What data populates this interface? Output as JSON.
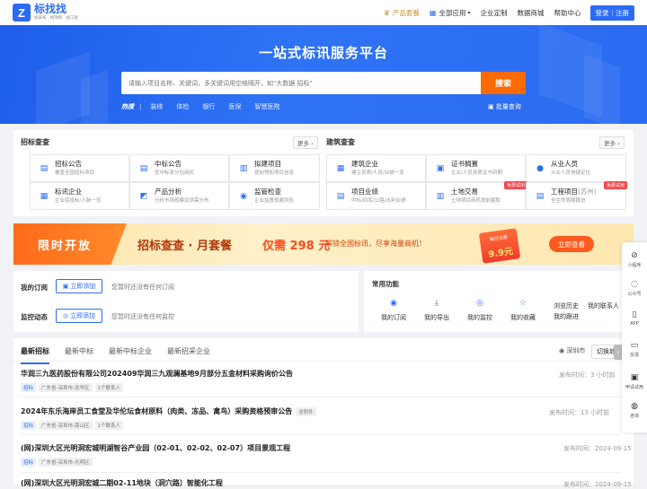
{
  "header": {
    "logo_name": "标找找",
    "logo_slogan": "找采购 · 找项目 · 找工程",
    "nav": {
      "product": "产品套餐",
      "apps": "全部应用",
      "enterprise": "企业定制",
      "data": "数据商城",
      "help": "帮助中心",
      "login": "登录｜注册"
    }
  },
  "hero": {
    "title": "一站式标讯服务平台",
    "search_placeholder": "请输入项目名称、关键词，多关键词用空格隔开，如\"大数据 招标\"",
    "search_button": "搜索",
    "hot_label": "热搜",
    "hot_keywords": [
      "装修",
      "体检",
      "银行",
      "医保",
      "智慧医院"
    ],
    "batch": "批量查询"
  },
  "bid_query": {
    "title": "招标查查",
    "more": "更多",
    "items": [
      {
        "title": "招标公告",
        "sub": "覆盖全国招标项目",
        "icon": "bid-notice-icon"
      },
      {
        "title": "中标公告",
        "sub": "查中标掌分包商机",
        "icon": "win-notice-icon"
      },
      {
        "title": "拟建项目",
        "sub": "提前预知项目信息",
        "icon": "planned-project-icon"
      },
      {
        "title": "标讯企业",
        "sub": "企业招投标/人脉一览",
        "icon": "company-icon"
      },
      {
        "title": "产品分析",
        "sub": "分析市场规模及供需分布",
        "icon": "product-analysis-icon"
      },
      {
        "title": "监管检查",
        "sub": "企业监督规避风险",
        "icon": "inspection-icon"
      }
    ]
  },
  "construction": {
    "title": "建筑查查",
    "more": "更多",
    "items": [
      {
        "title": "建筑企业",
        "sub": "建企资质/人员/业绩一览",
        "icon": "building-company-icon"
      },
      {
        "title": "证书搁置",
        "sub": "企业/人员资质证书到期",
        "icon": "certificate-icon"
      },
      {
        "title": "从业人员",
        "sub": "从业人员快捷定位",
        "icon": "staff-icon"
      },
      {
        "title": "项目业绩",
        "sub": "中标/四库/公路/水利业绩",
        "icon": "project-record-icon"
      },
      {
        "title": "土地交易",
        "sub": "土地项目商机提前掘取",
        "icon": "land-icon",
        "badge": "免费试用"
      },
      {
        "title": "工程项目",
        "title_extra": "(苏州)",
        "sub": "全生命周期跟进",
        "icon": "engineering-icon",
        "badge": "免费试用"
      }
    ]
  },
  "promo": {
    "tag": "限时开放",
    "title": "招标查查 · 月套餐",
    "price": "仅需 298 元",
    "desc": "解锁全国标讯，尽享海量商机！",
    "coupon_top": "每日优惠",
    "coupon_price": "9.9元",
    "button": "立即查看"
  },
  "subscription": {
    "label": "我的订阅",
    "button": "立即添加",
    "empty": "您暂时还没有任何订阅"
  },
  "monitor": {
    "label": "监控动态",
    "button": "立即添加",
    "empty": "您暂时还没有任何监控"
  },
  "functions": {
    "title": "常用功能",
    "items": [
      {
        "label": "我的订阅",
        "icon": "eye-icon"
      },
      {
        "label": "我的导出",
        "icon": "download-icon"
      },
      {
        "label": "我的监控",
        "icon": "monitor-icon"
      },
      {
        "label": "我的收藏",
        "icon": "star-icon"
      }
    ],
    "side": [
      "浏览历史",
      "我的联系人",
      "我的跟进"
    ]
  },
  "tabs": [
    "最新招标",
    "最新中标",
    "最新中标企业",
    "最新招采企业"
  ],
  "location": "深圳市",
  "switch_city": "切换城",
  "tenders": [
    {
      "title": "华润三九医药股份有限公司202409华润三九观澜基地9月部分五金材料采购询价公告",
      "announce": "",
      "tags": [
        "招标",
        "广东省-深圳市-龙华区",
        "1个联系人"
      ],
      "date": "发布时间：3 小时前"
    },
    {
      "title": "2024年东乐海岸员工食堂及华伦坛食材原料（肉类、冻品、禽鸟）采购资格预审公告",
      "announce": "含附件",
      "tags": [
        "招标",
        "广东省-深圳市-南山区",
        "1个联系人"
      ],
      "date": "发布时间：13 小时前"
    },
    {
      "title": "(网)深圳大区光明洞宏城明湖智谷产业园（02-01、02-02、02-07）项目景观工程",
      "announce": "",
      "tags": [
        "招标",
        "广东省-深圳市-光明区"
      ],
      "date": "发布时间：2024-09-15"
    },
    {
      "title": "(网)深圳大区光明洞宏城二期02-11地块（洞穴路）智能化工程",
      "announce": "",
      "tags": [],
      "date": "发布时间：2024-09-15"
    }
  ],
  "float_bar": [
    {
      "label": "小程序",
      "icon": "mini-program-icon"
    },
    {
      "label": "公众号",
      "icon": "wechat-icon"
    },
    {
      "label": "APP",
      "icon": "app-icon"
    },
    {
      "label": "反馈",
      "icon": "feedback-icon"
    },
    {
      "label": "申请试用",
      "icon": "trial-icon"
    },
    {
      "label": "咨询",
      "icon": "headset-icon"
    }
  ],
  "colors": {
    "primary": "#2b6cf6",
    "accent": "#ff6a00"
  }
}
